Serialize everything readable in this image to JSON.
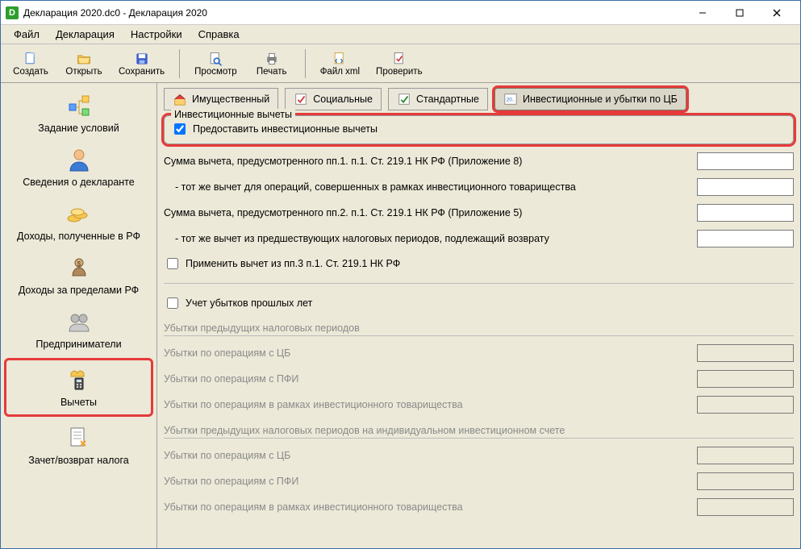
{
  "window": {
    "title": "Декларация 2020.dc0 - Декларация 2020",
    "app_icon_letter": "D"
  },
  "menubar": {
    "file": "Файл",
    "declaration": "Декларация",
    "settings": "Настройки",
    "help": "Справка"
  },
  "toolbar": {
    "create": "Создать",
    "open": "Открыть",
    "save": "Сохранить",
    "preview": "Просмотр",
    "print": "Печать",
    "file_xml": "Файл xml",
    "check": "Проверить"
  },
  "sidebar": {
    "conditions": "Задание условий",
    "declarant": "Сведения о декларанте",
    "income_rf": "Доходы, полученные в РФ",
    "income_abroad": "Доходы за пределами РФ",
    "entrepreneurs": "Предприниматели",
    "deductions": "Вычеты",
    "offset_refund": "Зачет/возврат налога"
  },
  "tabs": {
    "property": "Имущественный",
    "social": "Социальные",
    "standard": "Стандартные",
    "investment": "Инвестиционные и убытки по ЦБ"
  },
  "invest_group": {
    "title": "Инвестиционные вычеты",
    "provide_checkbox": "Предоставить инвестиционные вычеты"
  },
  "fields": {
    "sum_pp1": "Сумма вычета, предусмотренного пп.1. п.1. Ст. 219.1 НК РФ (Приложение 8)",
    "sum_pp1_sub": "- тот же вычет для операций, совершенных в рамках инвестиционного товарищества",
    "sum_pp2": "Сумма вычета, предусмотренного пп.2. п.1. Ст. 219.1 НК РФ (Приложение 5)",
    "sum_pp2_sub": "- тот же вычет из предшествующих налоговых периодов, подлежащий возврату",
    "apply_pp3": "Применить вычет из пп.3 п.1. Ст. 219.1 НК РФ",
    "account_losses": "Учет убытков прошлых лет",
    "losses_prev_header": "Убытки предыдущих налоговых периодов",
    "losses_cb": "Убытки по операциям с ЦБ",
    "losses_pfi": "Убытки по операциям с ПФИ",
    "losses_partnership": "Убытки по операциям в рамках инвестиционного товарищества",
    "losses_iis_header": "Убытки предыдущих налоговых периодов на индивидуальном инвестиционном счете"
  }
}
